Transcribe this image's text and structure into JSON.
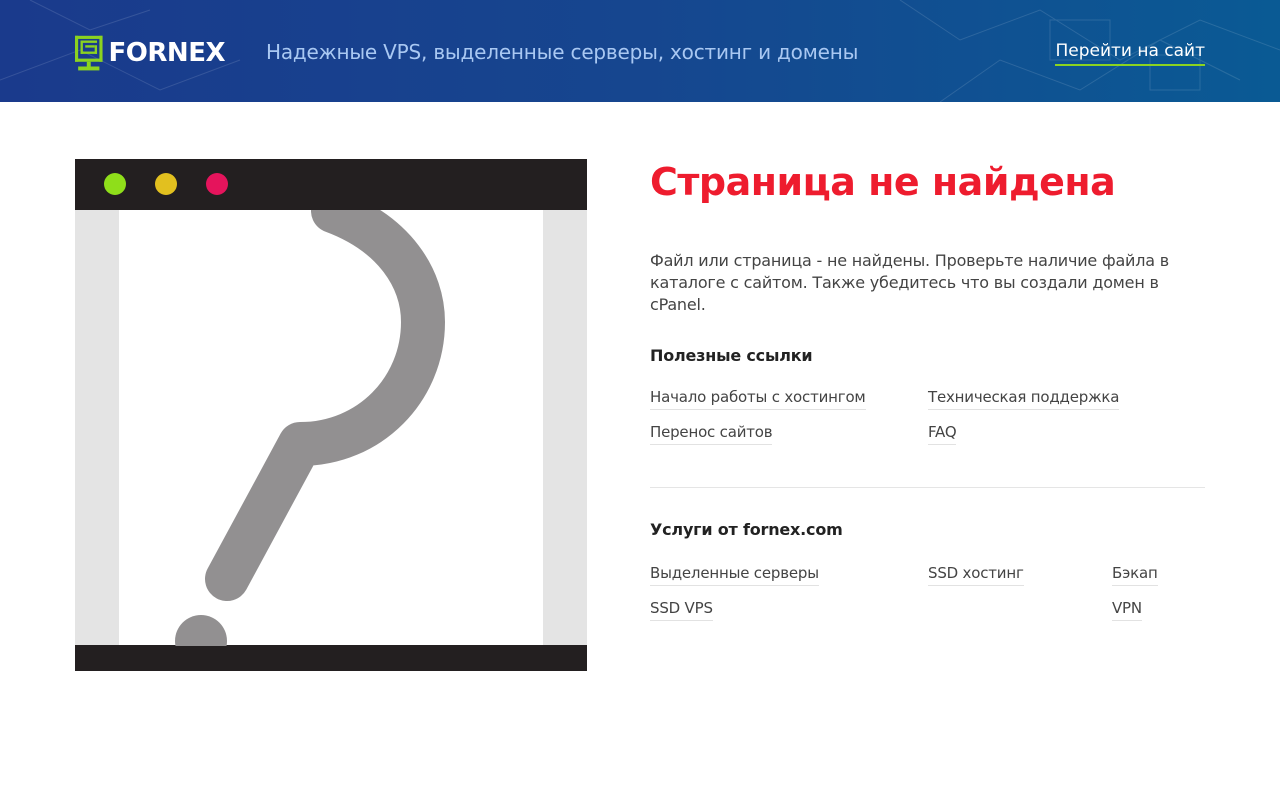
{
  "header": {
    "logo_text": "FORNEX",
    "tagline": "Надежные VPS, выделенные серверы, хостинг и домены",
    "goto_link": "Перейти на сайт"
  },
  "illustration": {
    "window_dots": [
      "#8fde1a",
      "#e2c01f",
      "#e5145c"
    ],
    "icon": "question-mark-icon"
  },
  "error": {
    "title": "Страница не найдена",
    "description": "Файл или страница - не найдены. Проверьте наличие файла в каталоге с сайтом. Также убедитесь что вы создали домен в cPanel."
  },
  "useful_links": {
    "title": "Полезные ссылки",
    "items": [
      "Начало работы с хостингом",
      "Техническая поддержка",
      "Перенос сайтов",
      "FAQ"
    ]
  },
  "services": {
    "title": "Услуги от fornex.com",
    "items": [
      "Выделенные серверы",
      "SSD хостинг",
      "Бэкап",
      "SSD VPS",
      "VPN"
    ]
  },
  "colors": {
    "accent_red": "#ee1c2e",
    "accent_green": "#8bd320",
    "header_blue": "#16468f"
  }
}
